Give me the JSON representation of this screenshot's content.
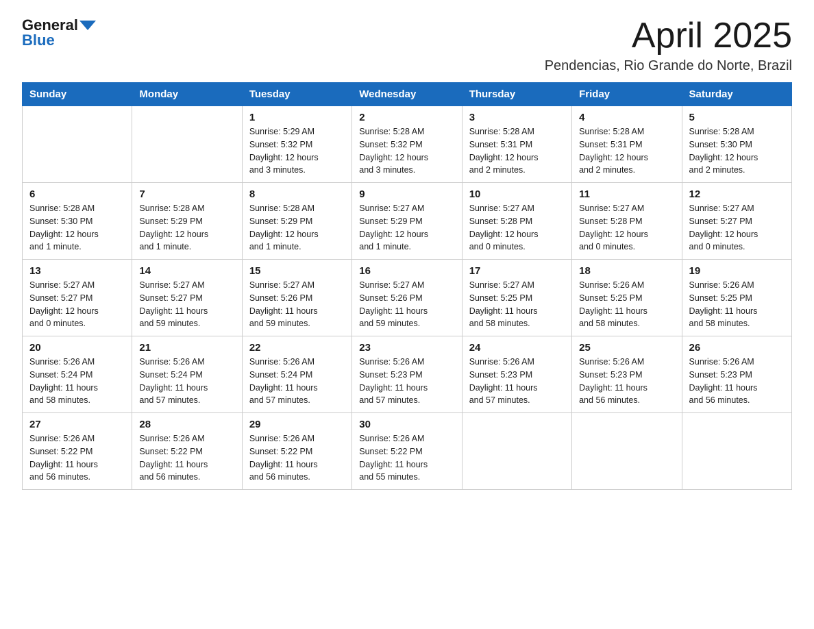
{
  "logo": {
    "general": "General",
    "blue": "Blue"
  },
  "header": {
    "month": "April 2025",
    "location": "Pendencias, Rio Grande do Norte, Brazil"
  },
  "weekdays": [
    "Sunday",
    "Monday",
    "Tuesday",
    "Wednesday",
    "Thursday",
    "Friday",
    "Saturday"
  ],
  "weeks": [
    [
      {
        "day": "",
        "info": ""
      },
      {
        "day": "",
        "info": ""
      },
      {
        "day": "1",
        "info": "Sunrise: 5:29 AM\nSunset: 5:32 PM\nDaylight: 12 hours\nand 3 minutes."
      },
      {
        "day": "2",
        "info": "Sunrise: 5:28 AM\nSunset: 5:32 PM\nDaylight: 12 hours\nand 3 minutes."
      },
      {
        "day": "3",
        "info": "Sunrise: 5:28 AM\nSunset: 5:31 PM\nDaylight: 12 hours\nand 2 minutes."
      },
      {
        "day": "4",
        "info": "Sunrise: 5:28 AM\nSunset: 5:31 PM\nDaylight: 12 hours\nand 2 minutes."
      },
      {
        "day": "5",
        "info": "Sunrise: 5:28 AM\nSunset: 5:30 PM\nDaylight: 12 hours\nand 2 minutes."
      }
    ],
    [
      {
        "day": "6",
        "info": "Sunrise: 5:28 AM\nSunset: 5:30 PM\nDaylight: 12 hours\nand 1 minute."
      },
      {
        "day": "7",
        "info": "Sunrise: 5:28 AM\nSunset: 5:29 PM\nDaylight: 12 hours\nand 1 minute."
      },
      {
        "day": "8",
        "info": "Sunrise: 5:28 AM\nSunset: 5:29 PM\nDaylight: 12 hours\nand 1 minute."
      },
      {
        "day": "9",
        "info": "Sunrise: 5:27 AM\nSunset: 5:29 PM\nDaylight: 12 hours\nand 1 minute."
      },
      {
        "day": "10",
        "info": "Sunrise: 5:27 AM\nSunset: 5:28 PM\nDaylight: 12 hours\nand 0 minutes."
      },
      {
        "day": "11",
        "info": "Sunrise: 5:27 AM\nSunset: 5:28 PM\nDaylight: 12 hours\nand 0 minutes."
      },
      {
        "day": "12",
        "info": "Sunrise: 5:27 AM\nSunset: 5:27 PM\nDaylight: 12 hours\nand 0 minutes."
      }
    ],
    [
      {
        "day": "13",
        "info": "Sunrise: 5:27 AM\nSunset: 5:27 PM\nDaylight: 12 hours\nand 0 minutes."
      },
      {
        "day": "14",
        "info": "Sunrise: 5:27 AM\nSunset: 5:27 PM\nDaylight: 11 hours\nand 59 minutes."
      },
      {
        "day": "15",
        "info": "Sunrise: 5:27 AM\nSunset: 5:26 PM\nDaylight: 11 hours\nand 59 minutes."
      },
      {
        "day": "16",
        "info": "Sunrise: 5:27 AM\nSunset: 5:26 PM\nDaylight: 11 hours\nand 59 minutes."
      },
      {
        "day": "17",
        "info": "Sunrise: 5:27 AM\nSunset: 5:25 PM\nDaylight: 11 hours\nand 58 minutes."
      },
      {
        "day": "18",
        "info": "Sunrise: 5:26 AM\nSunset: 5:25 PM\nDaylight: 11 hours\nand 58 minutes."
      },
      {
        "day": "19",
        "info": "Sunrise: 5:26 AM\nSunset: 5:25 PM\nDaylight: 11 hours\nand 58 minutes."
      }
    ],
    [
      {
        "day": "20",
        "info": "Sunrise: 5:26 AM\nSunset: 5:24 PM\nDaylight: 11 hours\nand 58 minutes."
      },
      {
        "day": "21",
        "info": "Sunrise: 5:26 AM\nSunset: 5:24 PM\nDaylight: 11 hours\nand 57 minutes."
      },
      {
        "day": "22",
        "info": "Sunrise: 5:26 AM\nSunset: 5:24 PM\nDaylight: 11 hours\nand 57 minutes."
      },
      {
        "day": "23",
        "info": "Sunrise: 5:26 AM\nSunset: 5:23 PM\nDaylight: 11 hours\nand 57 minutes."
      },
      {
        "day": "24",
        "info": "Sunrise: 5:26 AM\nSunset: 5:23 PM\nDaylight: 11 hours\nand 57 minutes."
      },
      {
        "day": "25",
        "info": "Sunrise: 5:26 AM\nSunset: 5:23 PM\nDaylight: 11 hours\nand 56 minutes."
      },
      {
        "day": "26",
        "info": "Sunrise: 5:26 AM\nSunset: 5:23 PM\nDaylight: 11 hours\nand 56 minutes."
      }
    ],
    [
      {
        "day": "27",
        "info": "Sunrise: 5:26 AM\nSunset: 5:22 PM\nDaylight: 11 hours\nand 56 minutes."
      },
      {
        "day": "28",
        "info": "Sunrise: 5:26 AM\nSunset: 5:22 PM\nDaylight: 11 hours\nand 56 minutes."
      },
      {
        "day": "29",
        "info": "Sunrise: 5:26 AM\nSunset: 5:22 PM\nDaylight: 11 hours\nand 56 minutes."
      },
      {
        "day": "30",
        "info": "Sunrise: 5:26 AM\nSunset: 5:22 PM\nDaylight: 11 hours\nand 55 minutes."
      },
      {
        "day": "",
        "info": ""
      },
      {
        "day": "",
        "info": ""
      },
      {
        "day": "",
        "info": ""
      }
    ]
  ]
}
